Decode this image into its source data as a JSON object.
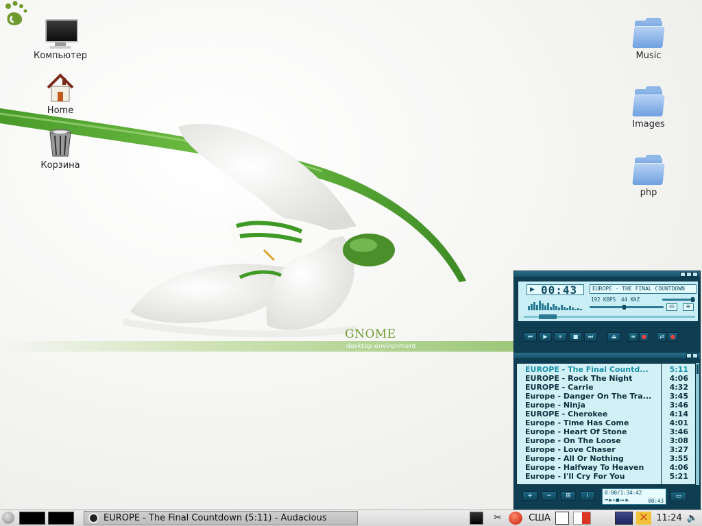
{
  "desktop": {
    "left_icons": [
      {
        "label": "Компьютер",
        "icon": "computer-icon"
      },
      {
        "label": "Home",
        "icon": "home-icon"
      },
      {
        "label": "Корзина",
        "icon": "trash-icon"
      }
    ],
    "right_icons": [
      {
        "label": "Music",
        "icon": "folder-icon"
      },
      {
        "label": "Images",
        "icon": "folder-icon"
      },
      {
        "label": "php",
        "icon": "folder-icon"
      }
    ],
    "wallpaper": {
      "logo": "GNOME",
      "subtitle": "desktop environment"
    }
  },
  "audacious": {
    "time_minutes": "00",
    "time_seconds": "43",
    "track_title": "EUROPE - THE FINAL COUNTDOWN",
    "bitrate": "192 KBPS",
    "samplerate": "44 KHZ",
    "controls": [
      "⏮",
      "▶",
      "⏸",
      "■",
      "⏭",
      "⏏",
      "≡",
      "●",
      "⇄",
      "●"
    ],
    "playlist": {
      "current_index": 0,
      "items": [
        {
          "title": "EUROPE - The Final Countd...",
          "duration": "5:11"
        },
        {
          "title": "EUROPE - Rock The Night",
          "duration": "4:06"
        },
        {
          "title": "EUROPE - Carrie",
          "duration": "4:32"
        },
        {
          "title": "Europe - Danger On The Tra...",
          "duration": "3:45"
        },
        {
          "title": "Europe - Ninja",
          "duration": "3:46"
        },
        {
          "title": "EUROPE - Cherokee",
          "duration": "4:14"
        },
        {
          "title": "Europe - Time Has Come",
          "duration": "4:01"
        },
        {
          "title": "Europe - Heart Of Stone",
          "duration": "3:46"
        },
        {
          "title": "Europe - On The Loose",
          "duration": "3:08"
        },
        {
          "title": "Europe - Love Chaser",
          "duration": "3:27"
        },
        {
          "title": "Europe - All Or Nothing",
          "duration": "3:55"
        },
        {
          "title": "Europe - Halfway To Heaven",
          "duration": "4:06"
        },
        {
          "title": "Europe - I'll Cry For You",
          "duration": "5:21"
        }
      ],
      "footer_buttons": [
        "+",
        "−",
        "⊞",
        "i"
      ],
      "total_counter": "0:00/1:34:42",
      "elapsed": "00:43"
    }
  },
  "panel": {
    "task_label": "EUROPE - The Final Countdown (5:11) - Audacious",
    "keyboard_layout": "США",
    "clock": "11:24",
    "tray_icons": [
      "terminal-icon",
      "scissors-icon",
      "red-app-icon",
      "window-icon",
      "applet-icon",
      "network-icon",
      "x-app-icon",
      "speaker-icon"
    ]
  }
}
